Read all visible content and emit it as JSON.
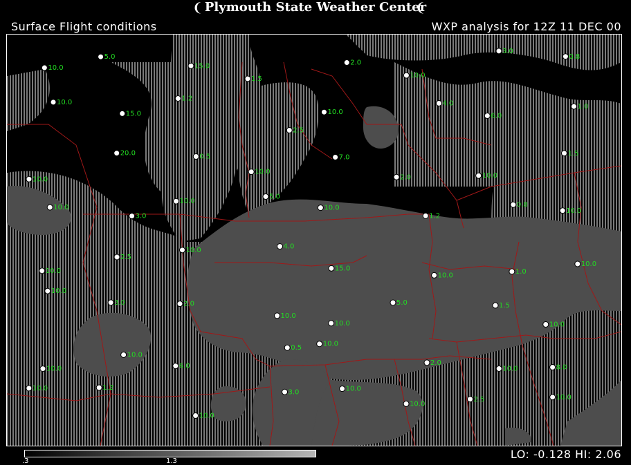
{
  "header": {
    "title": "Plymouth State Weather Center",
    "left_logo": "❨",
    "right_logo": "❨"
  },
  "subheader": {
    "product": "Surface Flight conditions",
    "analysis": "WXP analysis for 12Z 11 DEC 00"
  },
  "legend": {
    "tick_left": ".3",
    "tick_mid": "1.3",
    "stats": "LO: -0.128  HI:  2.06"
  },
  "colors": {
    "background": "#000000",
    "ifr_fill": "#4d4d4d",
    "hatch": "#7a7a7a",
    "borders": "#a01818",
    "station_text": "#22dd22",
    "weather_symbol": "#ffee33",
    "station_circle": "#ffffff"
  },
  "stations": [
    {
      "v": "10.0"
    },
    {
      "v": "5.0"
    },
    {
      "v": "15.0"
    },
    {
      "v": "1.5"
    },
    {
      "v": "2.0"
    },
    {
      "v": "10.0"
    },
    {
      "v": "3.0"
    },
    {
      "v": "0.8"
    },
    {
      "v": "10.0"
    },
    {
      "v": "15.0"
    },
    {
      "v": "1.2"
    },
    {
      "v": "2.5"
    },
    {
      "v": "10.0"
    },
    {
      "v": "4.0"
    },
    {
      "v": "6.0"
    },
    {
      "v": "1.0"
    },
    {
      "v": "10.0"
    },
    {
      "v": "20.0"
    },
    {
      "v": "0.5"
    },
    {
      "v": "10.0"
    },
    {
      "v": "7.0"
    },
    {
      "v": "2.0"
    },
    {
      "v": "10.0"
    },
    {
      "v": "1.5"
    },
    {
      "v": "10.0"
    },
    {
      "v": "3.0"
    },
    {
      "v": "10.0"
    },
    {
      "v": "5.0"
    },
    {
      "v": "10.0"
    },
    {
      "v": "1.2"
    },
    {
      "v": "0.8"
    },
    {
      "v": "10.0"
    },
    {
      "v": "10.0"
    },
    {
      "v": "2.5"
    },
    {
      "v": "10.0"
    },
    {
      "v": "4.0"
    },
    {
      "v": "15.0"
    },
    {
      "v": "10.0"
    },
    {
      "v": "1.0"
    },
    {
      "v": "10.0"
    },
    {
      "v": "10.0"
    },
    {
      "v": "3.0"
    },
    {
      "v": "2.0"
    },
    {
      "v": "10.0"
    },
    {
      "v": "10.0"
    },
    {
      "v": "5.0"
    },
    {
      "v": "1.5"
    },
    {
      "v": "10.0"
    },
    {
      "v": "10.0"
    },
    {
      "v": "10.0"
    },
    {
      "v": "6.0"
    },
    {
      "v": "0.5"
    },
    {
      "v": "10.0"
    },
    {
      "v": "2.0"
    },
    {
      "v": "10.0"
    },
    {
      "v": "8.0"
    },
    {
      "v": "10.0"
    },
    {
      "v": "1.2"
    },
    {
      "v": "10.0"
    },
    {
      "v": "3.0"
    },
    {
      "v": "10.0"
    },
    {
      "v": "10.0"
    },
    {
      "v": "2.5"
    },
    {
      "v": "10.0"
    }
  ]
}
